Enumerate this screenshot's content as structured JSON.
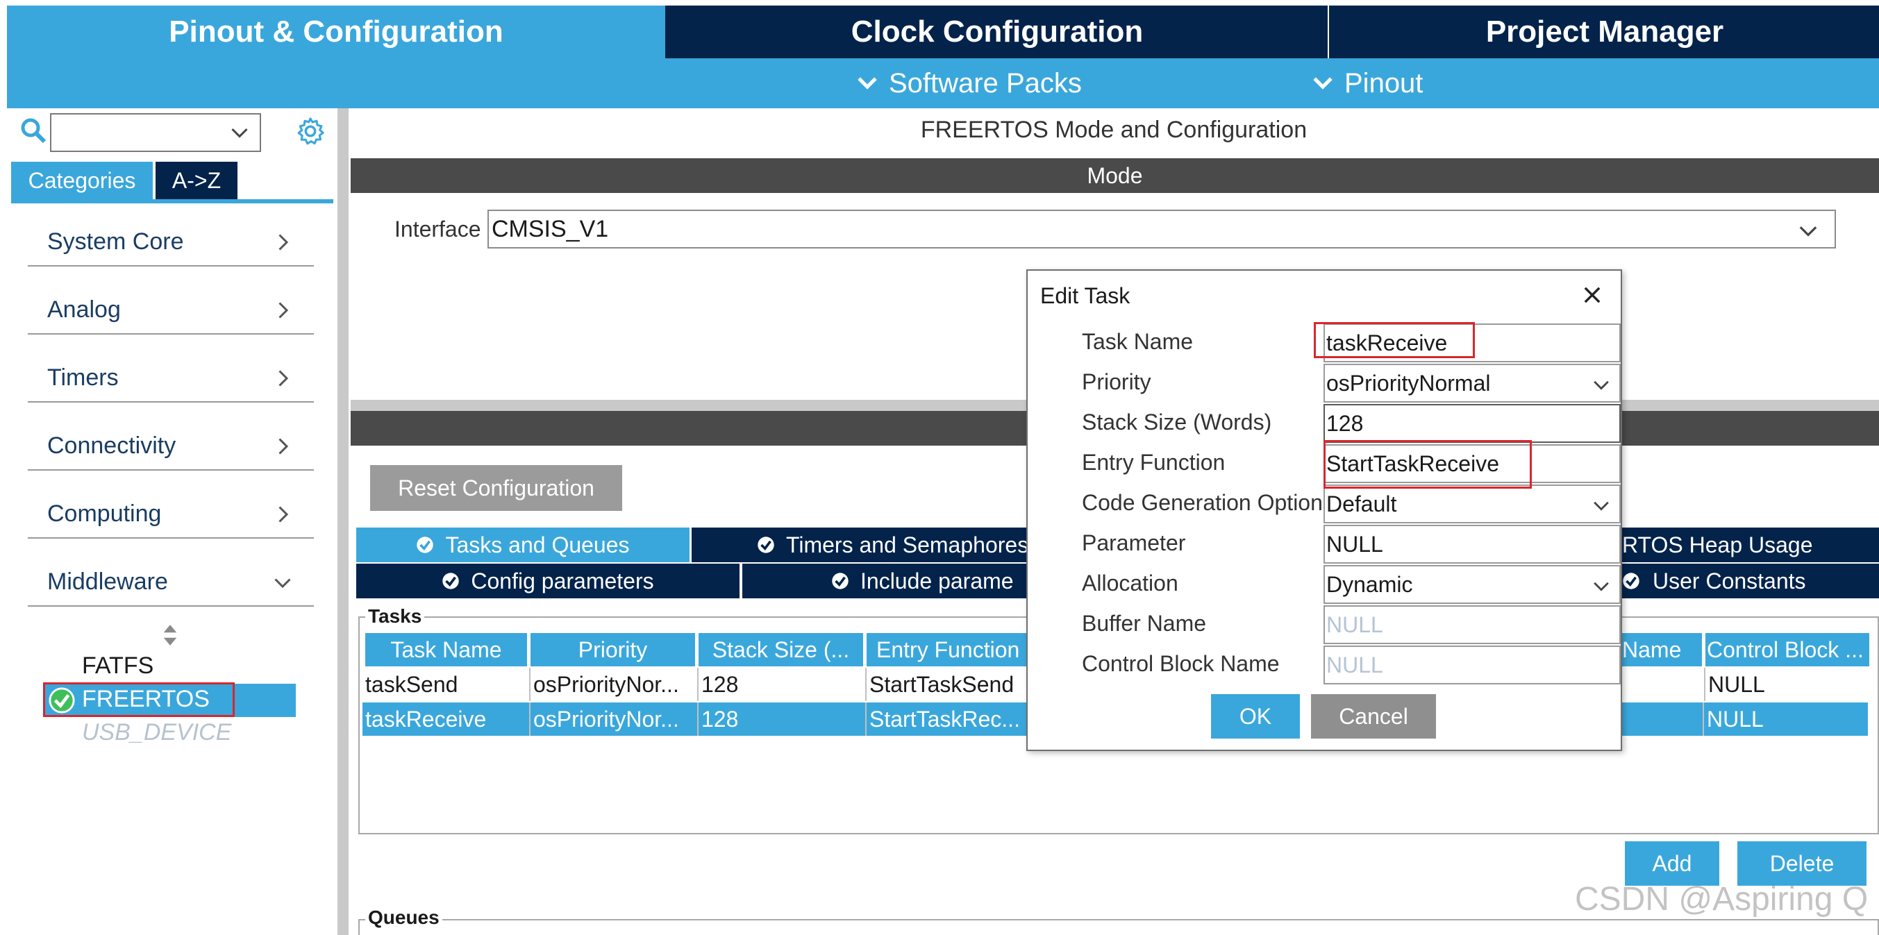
{
  "top_tabs": [
    "Pinout & Configuration",
    "Clock Configuration",
    "Project Manager"
  ],
  "sub_menu": [
    "Software Packs",
    "Pinout"
  ],
  "sidebar": {
    "category_tabs": [
      "Categories",
      "A->Z"
    ],
    "categories": [
      "System Core",
      "Analog",
      "Timers",
      "Connectivity",
      "Computing",
      "Middleware"
    ],
    "middleware_items": [
      "FATFS",
      "FREERTOS",
      "USB_DEVICE"
    ]
  },
  "main": {
    "title": "FREERTOS Mode and Configuration",
    "mode_header": "Mode",
    "interface_label": "Interface",
    "interface_value": "CMSIS_V1",
    "reset_button": "Reset Configuration",
    "tabs_row1": [
      "Tasks and Queues",
      "Timers and Semaphores",
      "RTOS Heap Usage"
    ],
    "tabs_row2": [
      "Config parameters",
      "Include parame",
      "User Constants"
    ],
    "tasks_group": "Tasks",
    "queues_group": "Queues",
    "tasks_columns": [
      "Task Name",
      "Priority",
      "Stack Size (...",
      "Entry Function",
      "Name",
      "Control Block ..."
    ],
    "tasks_rows": [
      {
        "name": "taskSend",
        "priority": "osPriorityNor...",
        "stack": "128",
        "entry": "StartTaskSend",
        "control": "NULL"
      },
      {
        "name": "taskReceive",
        "priority": "osPriorityNor...",
        "stack": "128",
        "entry": "StartTaskRec...",
        "control": "NULL"
      }
    ],
    "add_button": "Add",
    "delete_button": "Delete"
  },
  "dialog": {
    "title": "Edit Task",
    "labels": [
      "Task Name",
      "Priority",
      "Stack Size (Words)",
      "Entry Function",
      "Code Generation Option",
      "Parameter",
      "Allocation",
      "Buffer Name",
      "Control Block Name"
    ],
    "values": [
      "taskReceive",
      "osPriorityNormal",
      "128",
      "StartTaskReceive",
      "Default",
      "NULL",
      "Dynamic",
      "NULL",
      "NULL"
    ],
    "ok": "OK",
    "cancel": "Cancel"
  },
  "watermark": "CSDN @Aspiring Q",
  "colors": {
    "accent_blue": "#3aa7dc",
    "navy": "#03234b",
    "highlight_red": "#d9262c",
    "check_green": "#3fbf5a"
  }
}
